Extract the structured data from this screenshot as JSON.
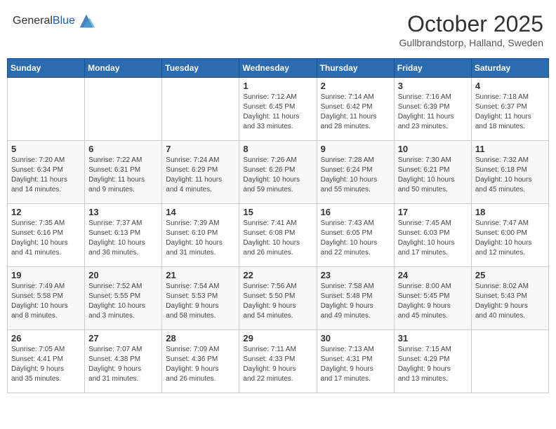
{
  "header": {
    "logo_general": "General",
    "logo_blue": "Blue",
    "month_year": "October 2025",
    "location": "Gullbrandstorp, Halland, Sweden"
  },
  "days_of_week": [
    "Sunday",
    "Monday",
    "Tuesday",
    "Wednesday",
    "Thursday",
    "Friday",
    "Saturday"
  ],
  "weeks": [
    [
      {
        "day": "",
        "info": ""
      },
      {
        "day": "",
        "info": ""
      },
      {
        "day": "",
        "info": ""
      },
      {
        "day": "1",
        "info": "Sunrise: 7:12 AM\nSunset: 6:45 PM\nDaylight: 11 hours\nand 33 minutes."
      },
      {
        "day": "2",
        "info": "Sunrise: 7:14 AM\nSunset: 6:42 PM\nDaylight: 11 hours\nand 28 minutes."
      },
      {
        "day": "3",
        "info": "Sunrise: 7:16 AM\nSunset: 6:39 PM\nDaylight: 11 hours\nand 23 minutes."
      },
      {
        "day": "4",
        "info": "Sunrise: 7:18 AM\nSunset: 6:37 PM\nDaylight: 11 hours\nand 18 minutes."
      }
    ],
    [
      {
        "day": "5",
        "info": "Sunrise: 7:20 AM\nSunset: 6:34 PM\nDaylight: 11 hours\nand 14 minutes."
      },
      {
        "day": "6",
        "info": "Sunrise: 7:22 AM\nSunset: 6:31 PM\nDaylight: 11 hours\nand 9 minutes."
      },
      {
        "day": "7",
        "info": "Sunrise: 7:24 AM\nSunset: 6:29 PM\nDaylight: 11 hours\nand 4 minutes."
      },
      {
        "day": "8",
        "info": "Sunrise: 7:26 AM\nSunset: 6:26 PM\nDaylight: 10 hours\nand 59 minutes."
      },
      {
        "day": "9",
        "info": "Sunrise: 7:28 AM\nSunset: 6:24 PM\nDaylight: 10 hours\nand 55 minutes."
      },
      {
        "day": "10",
        "info": "Sunrise: 7:30 AM\nSunset: 6:21 PM\nDaylight: 10 hours\nand 50 minutes."
      },
      {
        "day": "11",
        "info": "Sunrise: 7:32 AM\nSunset: 6:18 PM\nDaylight: 10 hours\nand 45 minutes."
      }
    ],
    [
      {
        "day": "12",
        "info": "Sunrise: 7:35 AM\nSunset: 6:16 PM\nDaylight: 10 hours\nand 41 minutes."
      },
      {
        "day": "13",
        "info": "Sunrise: 7:37 AM\nSunset: 6:13 PM\nDaylight: 10 hours\nand 36 minutes."
      },
      {
        "day": "14",
        "info": "Sunrise: 7:39 AM\nSunset: 6:10 PM\nDaylight: 10 hours\nand 31 minutes."
      },
      {
        "day": "15",
        "info": "Sunrise: 7:41 AM\nSunset: 6:08 PM\nDaylight: 10 hours\nand 26 minutes."
      },
      {
        "day": "16",
        "info": "Sunrise: 7:43 AM\nSunset: 6:05 PM\nDaylight: 10 hours\nand 22 minutes."
      },
      {
        "day": "17",
        "info": "Sunrise: 7:45 AM\nSunset: 6:03 PM\nDaylight: 10 hours\nand 17 minutes."
      },
      {
        "day": "18",
        "info": "Sunrise: 7:47 AM\nSunset: 6:00 PM\nDaylight: 10 hours\nand 12 minutes."
      }
    ],
    [
      {
        "day": "19",
        "info": "Sunrise: 7:49 AM\nSunset: 5:58 PM\nDaylight: 10 hours\nand 8 minutes."
      },
      {
        "day": "20",
        "info": "Sunrise: 7:52 AM\nSunset: 5:55 PM\nDaylight: 10 hours\nand 3 minutes."
      },
      {
        "day": "21",
        "info": "Sunrise: 7:54 AM\nSunset: 5:53 PM\nDaylight: 9 hours\nand 58 minutes."
      },
      {
        "day": "22",
        "info": "Sunrise: 7:56 AM\nSunset: 5:50 PM\nDaylight: 9 hours\nand 54 minutes."
      },
      {
        "day": "23",
        "info": "Sunrise: 7:58 AM\nSunset: 5:48 PM\nDaylight: 9 hours\nand 49 minutes."
      },
      {
        "day": "24",
        "info": "Sunrise: 8:00 AM\nSunset: 5:45 PM\nDaylight: 9 hours\nand 45 minutes."
      },
      {
        "day": "25",
        "info": "Sunrise: 8:02 AM\nSunset: 5:43 PM\nDaylight: 9 hours\nand 40 minutes."
      }
    ],
    [
      {
        "day": "26",
        "info": "Sunrise: 7:05 AM\nSunset: 4:41 PM\nDaylight: 9 hours\nand 35 minutes."
      },
      {
        "day": "27",
        "info": "Sunrise: 7:07 AM\nSunset: 4:38 PM\nDaylight: 9 hours\nand 31 minutes."
      },
      {
        "day": "28",
        "info": "Sunrise: 7:09 AM\nSunset: 4:36 PM\nDaylight: 9 hours\nand 26 minutes."
      },
      {
        "day": "29",
        "info": "Sunrise: 7:11 AM\nSunset: 4:33 PM\nDaylight: 9 hours\nand 22 minutes."
      },
      {
        "day": "30",
        "info": "Sunrise: 7:13 AM\nSunset: 4:31 PM\nDaylight: 9 hours\nand 17 minutes."
      },
      {
        "day": "31",
        "info": "Sunrise: 7:15 AM\nSunset: 4:29 PM\nDaylight: 9 hours\nand 13 minutes."
      },
      {
        "day": "",
        "info": ""
      }
    ]
  ]
}
